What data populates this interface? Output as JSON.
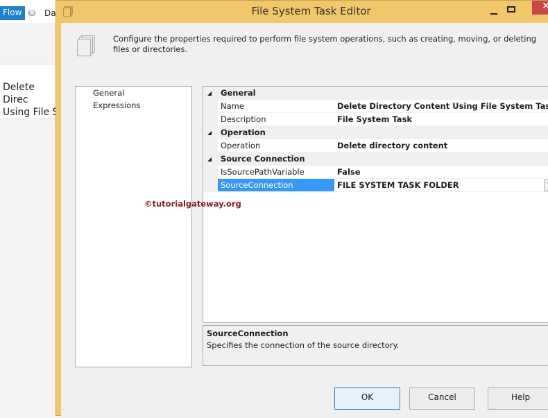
{
  "background": {
    "flow_tab": "Flow",
    "data_tab": "Da",
    "task_label": "Delete Direc\nUsing File S"
  },
  "dialog": {
    "title": "File System Task Editor",
    "description": "Configure the properties required to perform file system operations, such as creating, moving, or deleting files or directories.",
    "nav": [
      "General",
      "Expressions"
    ],
    "grid": [
      {
        "category": "General",
        "props": [
          {
            "name": "Name",
            "value": "Delete Directory Content Using File System Task"
          },
          {
            "name": "Description",
            "value": "File System Task"
          }
        ]
      },
      {
        "category": "Operation",
        "props": [
          {
            "name": "Operation",
            "value": "Delete directory content"
          }
        ]
      },
      {
        "category": "Source Connection",
        "props": [
          {
            "name": "IsSourcePathVariable",
            "value": "False"
          },
          {
            "name": "SourceConnection",
            "value": "FILE SYSTEM TASK FOLDER",
            "selected": true
          }
        ]
      }
    ],
    "help_title": "SourceConnection",
    "help_text": "Specifies the connection of the source directory.",
    "buttons": {
      "ok": "OK",
      "cancel": "Cancel",
      "help": "Help"
    },
    "watermark": "©tutorialgateway.org"
  },
  "colors": {
    "frame": "#f0c869",
    "selection": "#3399ff",
    "close": "#c7474a"
  }
}
